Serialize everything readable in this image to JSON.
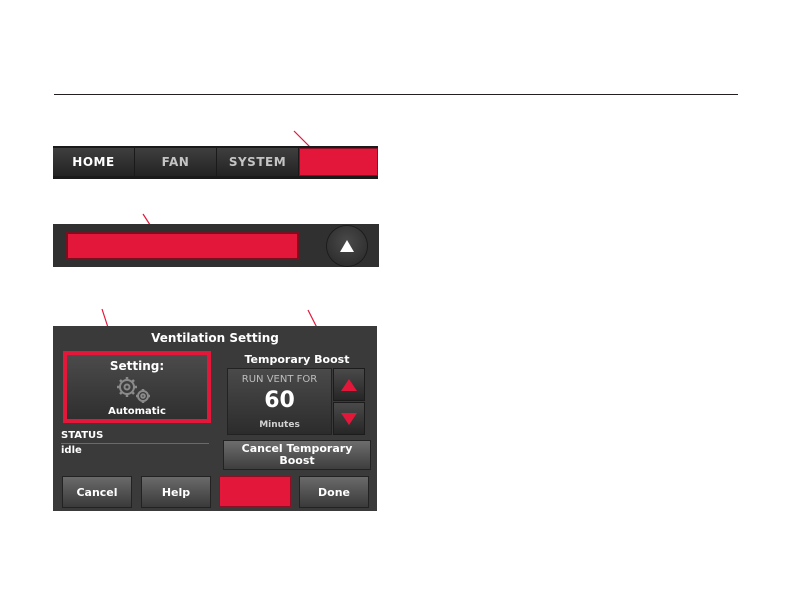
{
  "nav": {
    "tabs": [
      {
        "label": "HOME",
        "active": true
      },
      {
        "label": "FAN",
        "active": false
      },
      {
        "label": "SYSTEM",
        "active": false
      },
      {
        "label": "",
        "highlighted": true
      }
    ]
  },
  "ventilation": {
    "title": "Ventilation Setting",
    "setting_label": "Setting:",
    "setting_value": "Automatic",
    "status_label": "STATUS",
    "status_value": "idle",
    "boost_title": "Temporary Boost",
    "boost_caption": "RUN VENT FOR",
    "boost_value": "60",
    "boost_unit": "Minutes",
    "cancel_boost_label": "Cancel Temporary Boost",
    "buttons": {
      "cancel": "Cancel",
      "help": "Help",
      "done": "Done"
    }
  },
  "icons": {
    "scroll_up": "up-triangle-icon",
    "increase": "red-up-arrow-icon",
    "decrease": "red-down-arrow-icon",
    "setting": "gear-icon"
  },
  "colors": {
    "highlight": "#e3173a",
    "panel": "#3a3a3a",
    "text": "#ffffff"
  }
}
